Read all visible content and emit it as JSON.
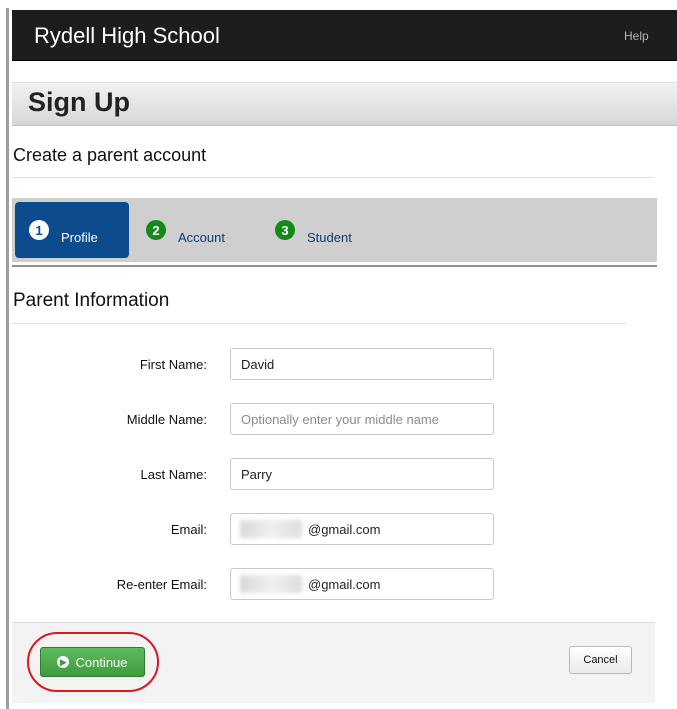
{
  "header": {
    "school_name": "Rydell High School",
    "help_label": "Help"
  },
  "page": {
    "title": "Sign Up",
    "subtitle": "Create a parent account"
  },
  "steps": [
    {
      "number": "1",
      "label": "Profile",
      "active": true
    },
    {
      "number": "2",
      "label": "Account",
      "active": false
    },
    {
      "number": "3",
      "label": "Student",
      "active": false
    }
  ],
  "form": {
    "section_title": "Parent Information",
    "fields": {
      "first_name": {
        "label": "First Name:",
        "value": "David"
      },
      "middle_name": {
        "label": "Middle Name:",
        "value": "",
        "placeholder": "Optionally enter your middle name"
      },
      "last_name": {
        "label": "Last Name:",
        "value": "Parry"
      },
      "email": {
        "label": "Email:",
        "value": "@gmail.com"
      },
      "reenter_email": {
        "label": "Re-enter Email:",
        "value": "@gmail.com"
      }
    }
  },
  "buttons": {
    "continue": "Continue",
    "cancel": "Cancel"
  },
  "colors": {
    "header_bg": "#1d1d1d",
    "step_active_bg": "#0c4b8c",
    "step_badge_green": "#118a1a",
    "continue_green": "#4cab4c",
    "highlight_red": "#d9191f"
  },
  "icons": {
    "continue": "arrow-circle-right-icon"
  }
}
